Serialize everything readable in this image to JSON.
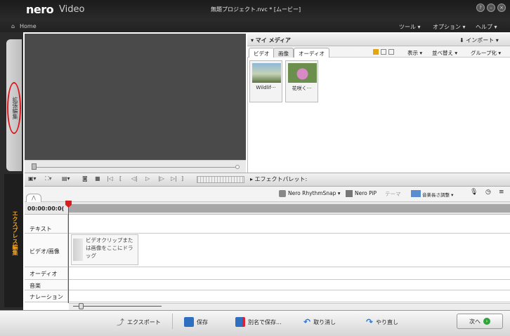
{
  "app": {
    "logo_brand": "nero",
    "logo_product": "Video",
    "window_title": "無題プロジェクト.nvc * [ムービー]",
    "home": "Home",
    "menu": [
      "ツール ▾",
      "オプション ▾",
      "ヘルプ ▾"
    ]
  },
  "side_tabs": {
    "advanced": "拡張編集",
    "express": "エクスプレス編集"
  },
  "media": {
    "title": "▾ マイ メディア",
    "import": "⬇ インポート ▾",
    "tabs": [
      "ビデオ",
      "画像",
      "オーディオ"
    ],
    "toolbar": [
      "表示 ▾",
      "並べ替え ▾",
      "グループ化 ▾"
    ],
    "items": [
      {
        "label": "Wildlif···",
        "thumb_colors": [
          "#6f9fc9",
          "#b9c9a6",
          "#5b7340"
        ]
      },
      {
        "label": "花咲く···",
        "thumb_colors": [
          "#6c8f4d",
          "#d98ac6",
          "#4d6a35"
        ]
      }
    ]
  },
  "effects": {
    "label": "▸ エフェクトパレット:",
    "buttons": [
      "Nero RhythmSnap ▾",
      "Nero PiP",
      "テーマ",
      "音楽長さ調整 ▾"
    ]
  },
  "timeline": {
    "timecode": "00:00:00:0(",
    "tracks": [
      "テキスト",
      "ビデオ/画像",
      "オーディオ",
      "音楽",
      "ナレーション"
    ],
    "drop_hint": "ビデオクリップまたは画像をここにドラッグ"
  },
  "bottom": {
    "export": "エクスポート",
    "save": "保存",
    "save_as": "別名で保存...",
    "undo": "取り消し",
    "redo": "やり直し",
    "next": "次へ"
  }
}
